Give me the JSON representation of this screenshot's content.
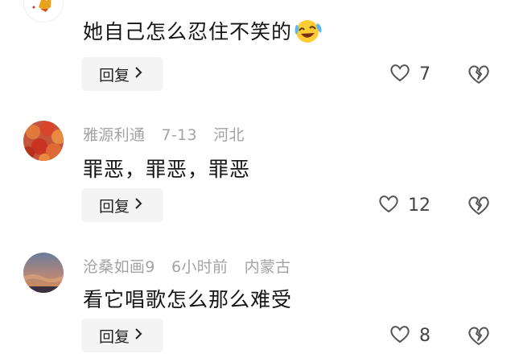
{
  "comments": [
    {
      "meta": [
        "",
        "",
        ""
      ],
      "text": "她自己怎么忍住不笑的",
      "emoji": "laughing-crying-emoji",
      "reply_label": "回复",
      "like_count": "7"
    },
    {
      "meta": [
        "雅源利通",
        "7-13",
        "河北"
      ],
      "text": "罪恶，罪恶，罪恶",
      "reply_label": "回复",
      "like_count": "12"
    },
    {
      "meta": [
        "沧桑如画9",
        "6小时前",
        "内蒙古"
      ],
      "text": "看它唱歌怎么那么难受",
      "reply_label": "回复",
      "like_count": "8"
    }
  ],
  "icons": {
    "like": "heart-outline-icon",
    "dislike": "broken-heart-icon",
    "reply_chevron": "chevron-right-icon"
  },
  "colors": {
    "meta_text": "#a3a3a3",
    "body_text": "#151515",
    "reply_bg": "#f4f4f4",
    "emoji_face": "#ffcc33"
  }
}
